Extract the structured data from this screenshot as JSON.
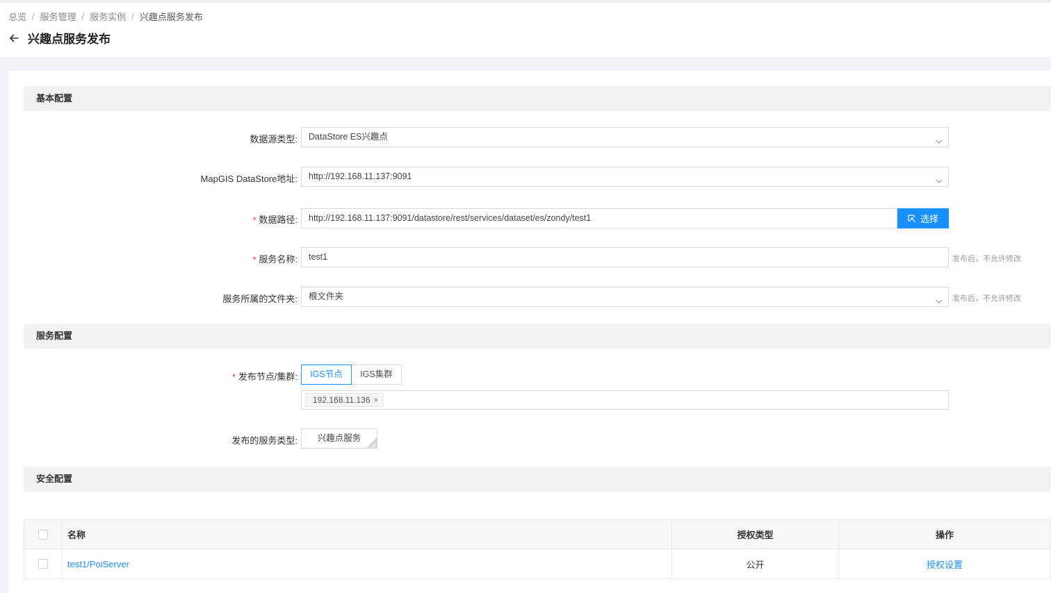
{
  "breadcrumb": {
    "items": [
      "总览",
      "服务管理",
      "服务实例"
    ],
    "current": "兴趣点服务发布",
    "separator": "/"
  },
  "page": {
    "title": "兴趣点服务发布"
  },
  "sections": {
    "basic": "基本配置",
    "service": "服务配置",
    "security": "安全配置"
  },
  "form": {
    "datasource_type": {
      "label": "数据源类型:",
      "value": "DataStore ES兴趣点"
    },
    "datastore_address": {
      "label": "MapGIS DataStore地址:",
      "value": "http://192.168.11.137:9091"
    },
    "data_path": {
      "label": "数据路径:",
      "value": "http://192.168.11.137:9091/datastore/rest/services/dataset/es/zondy/test1",
      "button": "选择"
    },
    "service_name": {
      "label": "服务名称:",
      "value": "test1",
      "hint": "发布后，不允许修改"
    },
    "folder": {
      "label": "服务所属的文件夹:",
      "value": "根文件夹",
      "hint": "发布后，不允许修改"
    },
    "publish_node": {
      "label": "发布节点/集群:",
      "options": [
        "IGS节点",
        "IGS集群"
      ],
      "selected": "IGS节点",
      "tags": [
        "192.168.11.136"
      ]
    },
    "service_type": {
      "label": "发布的服务类型:",
      "value": "兴趣点服务"
    }
  },
  "table": {
    "headers": {
      "name": "名称",
      "auth_type": "授权类型",
      "action": "操作"
    },
    "rows": [
      {
        "name": "test1/PoiServer",
        "auth_type": "公开",
        "action": "授权设置"
      }
    ]
  },
  "colors": {
    "primary": "#1890ff",
    "required": "#f5222d"
  }
}
